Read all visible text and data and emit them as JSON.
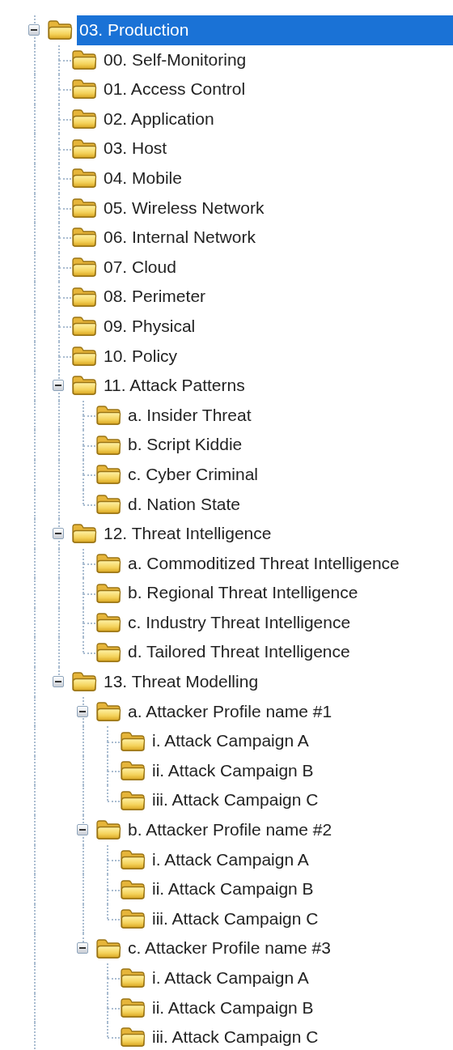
{
  "tree": [
    {
      "label": "03. Production",
      "selected": true,
      "expanded": true,
      "children": [
        {
          "label": "00. Self-Monitoring",
          "selected": false
        },
        {
          "label": "01. Access Control",
          "selected": false
        },
        {
          "label": "02. Application",
          "selected": false
        },
        {
          "label": "03. Host",
          "selected": false
        },
        {
          "label": "04. Mobile",
          "selected": false
        },
        {
          "label": "05. Wireless Network",
          "selected": false
        },
        {
          "label": "06. Internal Network",
          "selected": false
        },
        {
          "label": "07. Cloud",
          "selected": false
        },
        {
          "label": "08. Perimeter",
          "selected": false
        },
        {
          "label": "09. Physical",
          "selected": false
        },
        {
          "label": "10. Policy",
          "selected": false
        },
        {
          "label": "11. Attack Patterns",
          "selected": false,
          "expanded": true,
          "children": [
            {
              "label": "a. Insider Threat",
              "selected": false
            },
            {
              "label": "b. Script Kiddie",
              "selected": false
            },
            {
              "label": "c. Cyber Criminal",
              "selected": false
            },
            {
              "label": "d. Nation State",
              "selected": false
            }
          ]
        },
        {
          "label": "12. Threat Intelligence",
          "selected": false,
          "expanded": true,
          "children": [
            {
              "label": "a. Commoditized Threat Intelligence",
              "selected": false
            },
            {
              "label": "b. Regional Threat Intelligence",
              "selected": false
            },
            {
              "label": "c. Industry Threat Intelligence",
              "selected": false
            },
            {
              "label": "d. Tailored Threat Intelligence",
              "selected": false
            }
          ]
        },
        {
          "label": "13. Threat Modelling",
          "selected": false,
          "expanded": true,
          "children": [
            {
              "label": "a. Attacker Profile name #1",
              "selected": false,
              "expanded": true,
              "children": [
                {
                  "label": "i. Attack Campaign A",
                  "selected": false
                },
                {
                  "label": "ii. Attack Campaign B",
                  "selected": false
                },
                {
                  "label": "iii. Attack Campaign C",
                  "selected": false
                }
              ]
            },
            {
              "label": "b. Attacker Profile name #2",
              "selected": false,
              "expanded": true,
              "children": [
                {
                  "label": "i. Attack Campaign A",
                  "selected": false
                },
                {
                  "label": "ii. Attack Campaign B",
                  "selected": false
                },
                {
                  "label": "iii. Attack Campaign C",
                  "selected": false
                }
              ]
            },
            {
              "label": "c. Attacker Profile name #3",
              "selected": false,
              "expanded": true,
              "children": [
                {
                  "label": "i. Attack Campaign A",
                  "selected": false
                },
                {
                  "label": "ii. Attack Campaign B",
                  "selected": false
                },
                {
                  "label": "iii. Attack Campaign C",
                  "selected": false
                }
              ]
            }
          ]
        }
      ]
    }
  ]
}
